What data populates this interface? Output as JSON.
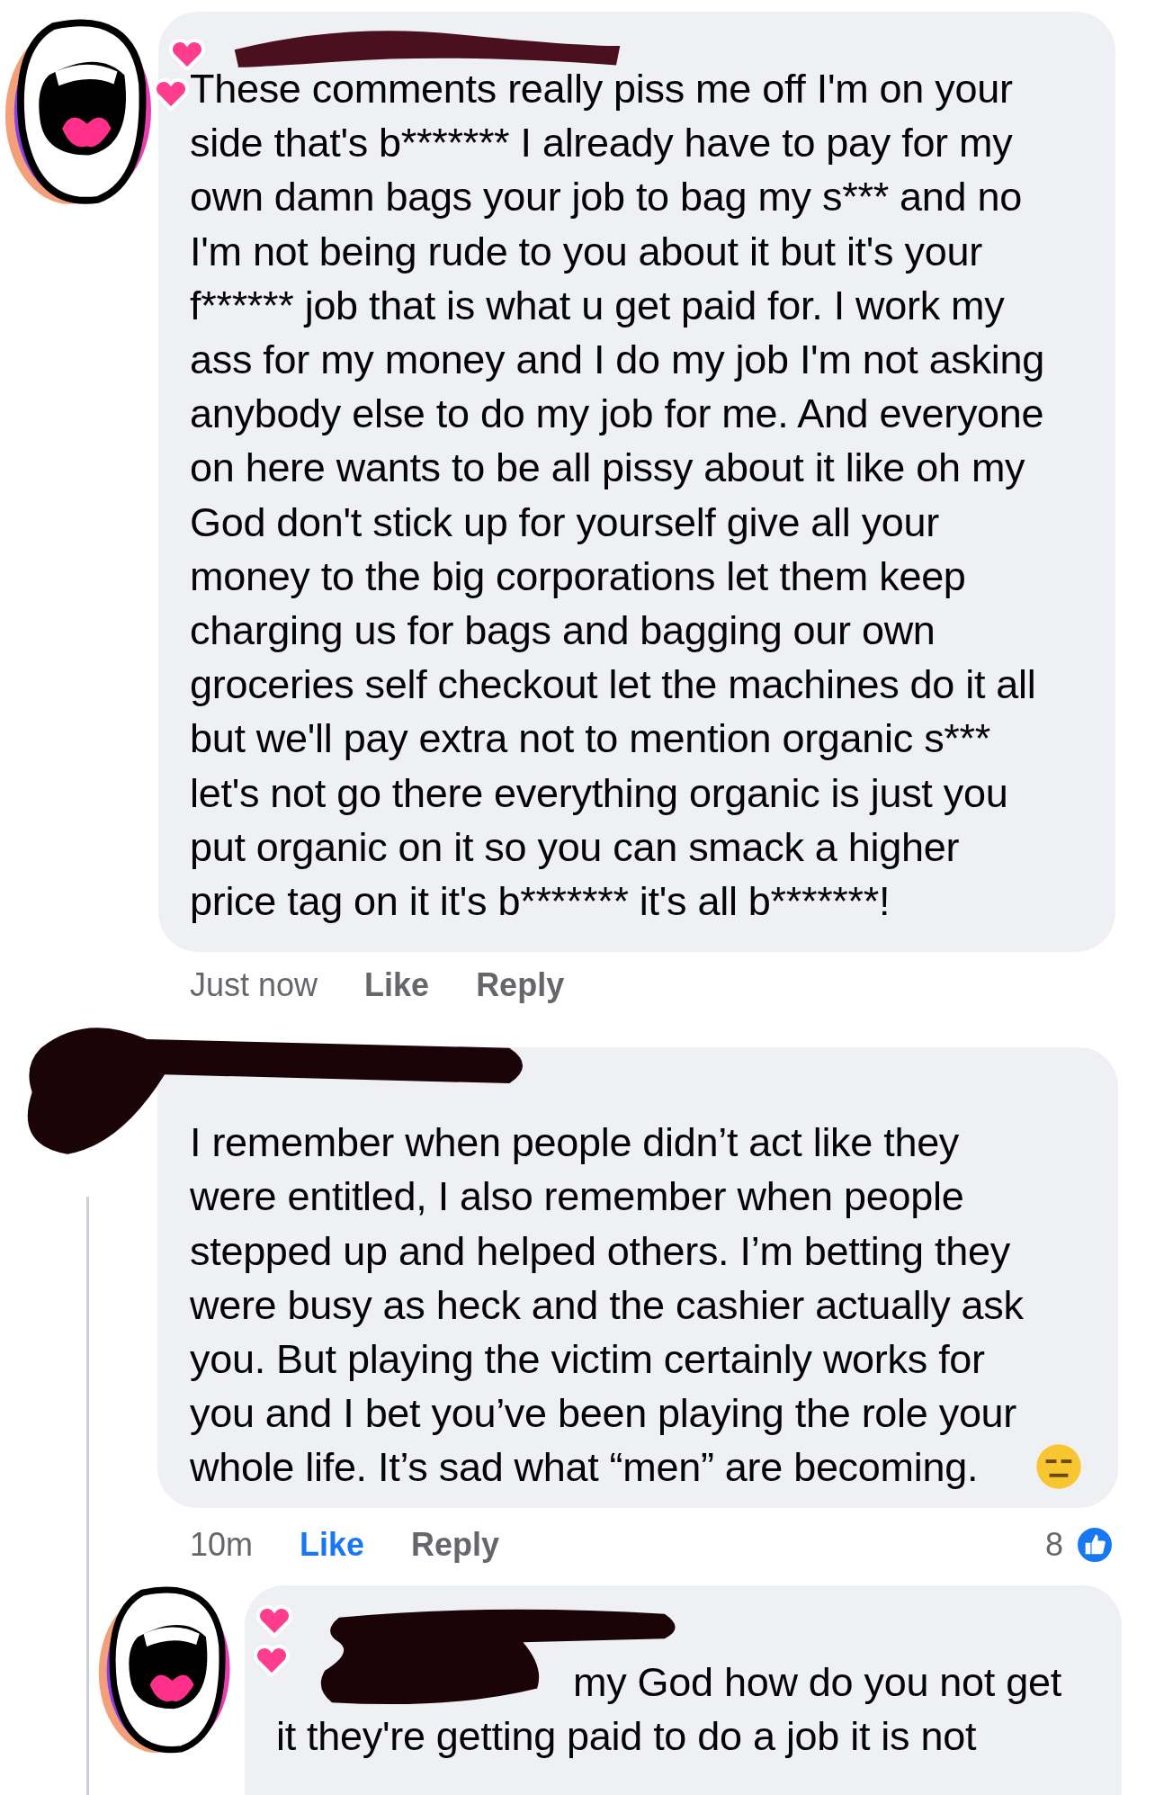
{
  "comments": [
    {
      "lines": [
        "These comments really piss me off I'm on your",
        "side that's b******* I already have to pay for my",
        "own damn bags your job to bag my s*** and no",
        "I'm not being rude to you about it but it's your",
        "f****** job that is what u get paid for. I work my",
        "ass for my money and I do my job I'm not asking",
        "anybody else to do my job for me. And everyone",
        "on here wants to be all pissy about it like oh my",
        "God don't stick up for yourself give all your",
        "money to the big corporations let them keep",
        "charging us for bags and bagging our own",
        "groceries self checkout let the machines do it all",
        "but we'll pay extra not to mention organic s***",
        "let's not go there everything organic is just you",
        "put organic on it so you can smack a higher",
        "price tag on it it's b******* it's all b*******!"
      ],
      "time": "Just now",
      "like": "Like",
      "liked": false,
      "reply": "Reply"
    },
    {
      "lines": [
        "I remember when people didn’t act like they",
        "were entitled, I also remember when people",
        "stepped up and helped others. I’m betting they",
        "were busy as heck and the cashier actually ask",
        "you. But playing the victim certainly works for",
        "you and I bet you’ve been playing the role your",
        "whole life. It’s sad what “men” are becoming."
      ],
      "time": "10m",
      "like": "Like",
      "liked": true,
      "reply": "Reply",
      "reaction_count": "8"
    }
  ],
  "reply": {
    "lines": [
      "my God how do you not get",
      "it they're getting paid to do a job it is not"
    ]
  }
}
